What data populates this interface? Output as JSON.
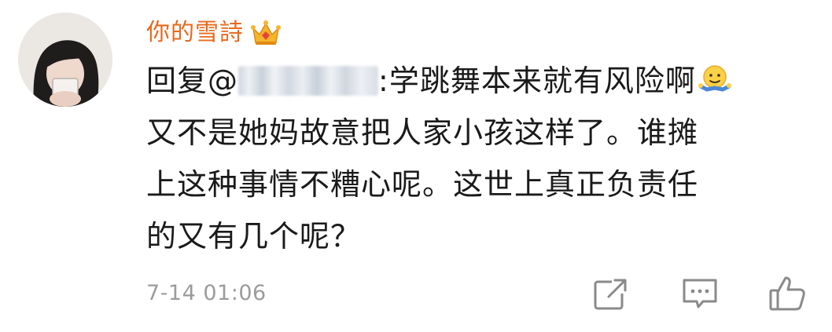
{
  "comment": {
    "username": "你的雪詩",
    "badge_icon": "vip-crown-icon",
    "reply_prefix": "回复@",
    "reply_separator": ":",
    "content_lines": [
      "学跳舞本来就有风险啊",
      "又不是她妈故意把人家小孩这样了。谁摊",
      "上这种事情不糟心呢。这世上真正负责任",
      "的又有几个呢？"
    ],
    "emoji_icon": "shrug-emoji-icon",
    "timestamp": "7-14 01:06"
  },
  "actions": {
    "repost_icon": "repost-icon",
    "comment_icon": "comment-icon",
    "like_icon": "like-icon"
  },
  "colors": {
    "username": "#e8691e",
    "text": "#1a1a1a",
    "meta": "#9b9b9b",
    "icon": "#8a8a8a"
  }
}
